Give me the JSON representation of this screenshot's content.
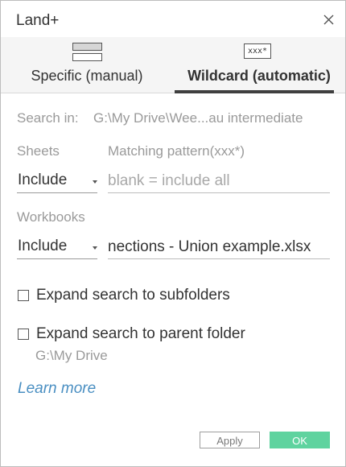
{
  "window": {
    "title": "Land+"
  },
  "icons": {
    "close": "close-icon",
    "manual": "stacked-sheets-icon",
    "wildcard": "wildcard-box-icon"
  },
  "tabs": [
    {
      "label": "Specific (manual)",
      "active": false
    },
    {
      "label": "Wildcard (automatic)",
      "active": true
    }
  ],
  "wildcard_icon_text": "xxx*",
  "search_in": {
    "label": "Search in:",
    "value": "G:\\My Drive\\Wee...au intermediate"
  },
  "sheets": {
    "label": "Sheets",
    "pattern_label": "Matching pattern(xxx*)",
    "mode": "Include",
    "pattern_value": "",
    "pattern_placeholder": "blank = include all"
  },
  "workbooks": {
    "label": "Workbooks",
    "mode": "Include",
    "pattern_value": "nections - Union example.xlsx"
  },
  "options": {
    "subfolders": {
      "label": "Expand search to subfolders",
      "checked": false
    },
    "parent": {
      "label": "Expand search to parent folder",
      "checked": false,
      "path": "G:\\My Drive"
    }
  },
  "learn_more": "Learn more",
  "buttons": {
    "apply": "Apply",
    "ok": "OK"
  },
  "colors": {
    "ok_button": "#5fd39f",
    "link": "#4a8fc2",
    "muted_text": "#9a9a9a",
    "tab_bar": "#f5f5f5"
  }
}
